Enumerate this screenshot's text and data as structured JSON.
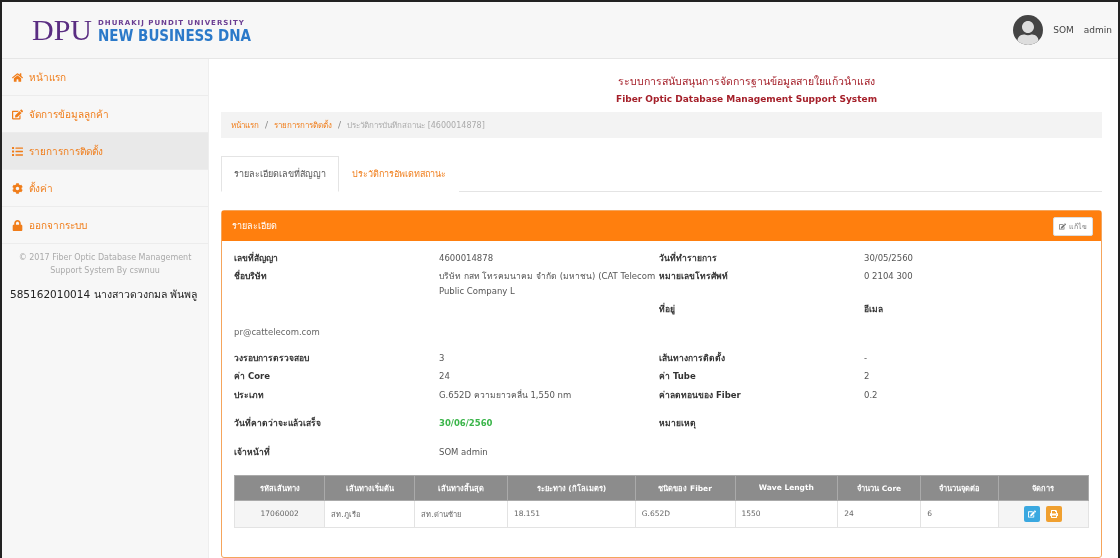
{
  "logo": {
    "mark": "DPU",
    "university": "DHURAKIJ PUNDIT UNIVERSITY",
    "tagline": "NEW BUSINESS DNA"
  },
  "user": {
    "first": "SOM",
    "last": "admin"
  },
  "sidebar": {
    "items": [
      {
        "label": "หน้าแรก",
        "kind": "home",
        "selected": false
      },
      {
        "label": "จัดการข้อมูลลูกค้า",
        "kind": "edit",
        "selected": false
      },
      {
        "label": "รายการการติดตั้ง",
        "kind": "list",
        "selected": true
      },
      {
        "label": "ตั้งค่า",
        "kind": "gear",
        "selected": false
      },
      {
        "label": "ออกจากระบบ",
        "kind": "lock",
        "selected": false
      }
    ],
    "copyright": "© 2017 Fiber Optic Database Management Support System By cswnuu",
    "student": "585162010014 นางสาวดวงกมล พันพลู"
  },
  "title": {
    "thai": "ระบบการสนับสนุนการจัดการฐานข้อมูลสายใยแก้วนำแสง",
    "english": "Fiber Optic Database Management Support System"
  },
  "breadcrumb": [
    {
      "label": "หน้าแรก",
      "link": true
    },
    {
      "label": "/",
      "kind": "separator"
    },
    {
      "label": "รายการการติดตั้ง",
      "link": true
    },
    {
      "label": "/",
      "kind": "separator"
    },
    {
      "label": "ประวัติการบันทึกสถานะ [4600014878]",
      "link": false
    }
  ],
  "tabs": [
    {
      "label": "รายละเอียดเลขที่สัญญา",
      "selected": true
    },
    {
      "label": "ประวัติการอัพเดทสถานะ",
      "selected": false
    }
  ],
  "panel": {
    "title": "รายละเอียด",
    "edit_button": "แก้ไข",
    "groups": [
      {
        "rows": [
          {
            "left": {
              "label": "เลขที่สัญญา",
              "value": "4600014878"
            },
            "right": {
              "label": "วันที่ทำรายการ",
              "value": "30/05/2560"
            }
          },
          {
            "left": {
              "label": "ชื่อบริษัท",
              "value": "บริษัท กสท โทรคมนาคม จำกัด (มหาชน) (CAT Telecom Public Company L"
            },
            "right": {
              "label": "หมายเลขโทรศัพท์",
              "value": "0 2104 300"
            }
          },
          {
            "right": {
              "label": "ที่อยู่",
              "value": "อีเมล",
              "bold": true
            }
          }
        ],
        "note": "pr@cattelecom.com"
      },
      {
        "rows": [
          {
            "left": {
              "label": "วงรอบการตรวจสอบ",
              "value": "3"
            },
            "right": {
              "label": "เส้นทางการติดตั้ง",
              "value": "-"
            }
          },
          {
            "left": {
              "label": "ค่า Core",
              "value": "24"
            },
            "right": {
              "label": "ค่า Tube",
              "value": "2"
            }
          },
          {
            "left": {
              "label": "ประเภท",
              "value": "G.652D ความยาวคลื่น 1,550 nm"
            },
            "right": {
              "label": "ค่าลดทอนของ Fiber",
              "value": "0.2"
            }
          }
        ]
      },
      {
        "rows": [
          {
            "left": {
              "label": "วันที่คาดว่าจะแล้วเสร็จ",
              "value": "30/06/2560",
              "highlighted": true
            },
            "right": {
              "label": "หมายเหตุ"
            }
          }
        ]
      },
      {
        "rows": [
          {
            "left": {
              "label": "เจ้าหน้าที่",
              "value": "SOM    admin"
            }
          }
        ]
      }
    ]
  },
  "table": {
    "columns": [
      "รหัสเส้นทาง",
      "เส้นทางเริ่มต้น",
      "เส้นทางสิ้นสุด",
      "ระยะทาง (กิโลเมตร)",
      "ชนิดของ Fiber",
      "Wave Length",
      "จำนวน Core",
      "จำนวนจุดต่อ",
      "จัดการ"
    ],
    "rows": [
      {
        "cells": [
          "17060002",
          "สท.ภูเรือ",
          "สท.ด่านซ้าย",
          "18.151",
          "G.652D",
          "1550",
          "24",
          "6"
        ]
      }
    ]
  }
}
